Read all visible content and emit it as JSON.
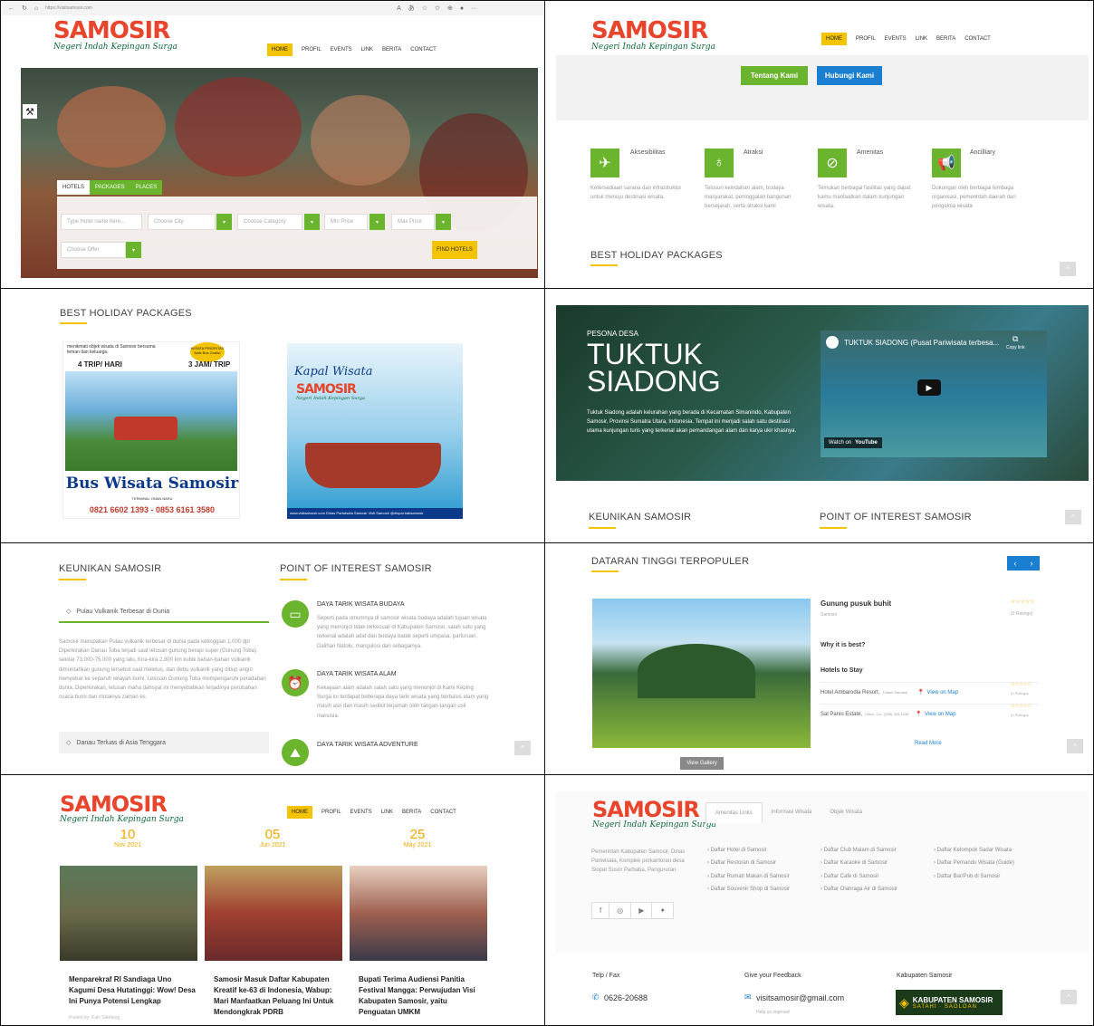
{
  "panel1": {
    "browser": {
      "url": "https://visitsamosir.com",
      "tab_icons": [
        "back-icon",
        "refresh-icon",
        "home-icon",
        "reader-icon",
        "zoom-icon",
        "translate-icon",
        "favorite-icon",
        "favorites-bar-icon",
        "extension-icon",
        "more-icon"
      ]
    },
    "logo": {
      "main": "SAMOSIR",
      "sub": "Negeri Indah Kepingan Surga"
    },
    "nav": [
      "HOME",
      "PROFIL",
      "EVENTS",
      "LINK",
      "BERITA",
      "CONTACT"
    ],
    "search_tabs": [
      "HOTELS",
      "PACKAGES",
      "PLACES"
    ],
    "fields": {
      "hotel": "Type Hotel name here...",
      "city": "Choose City",
      "category": "Choose Category",
      "min": "Min Price",
      "max": "Max Price",
      "offer": "Choose Offer"
    },
    "find_button": "FIND HOTELS"
  },
  "panel2": {
    "logo": {
      "main": "SAMOSIR",
      "sub": "Negeri Indah Kepingan Surga"
    },
    "nav": [
      "HOME",
      "PROFIL",
      "EVENTS",
      "LINK",
      "BERITA",
      "CONTACT"
    ],
    "buttons": {
      "about": "Tentang Kami",
      "contact": "Hubungi Kami"
    },
    "features": [
      {
        "title": "Aksesibilitas",
        "text": "Ketersediaan sarana dan infrastruktur untuk menuju destinasi wisata."
      },
      {
        "title": "Atraksi",
        "text": "Telusuri keindahan alam, budaya masyarakat, peninggalan bangunan bersejarah, serta atraksi kami"
      },
      {
        "title": "Amenitas",
        "text": "Temukan berbagai fasilitas yang dapat kamu manfaatkan dalam kunjungan wisata."
      },
      {
        "title": "Ancilliary",
        "text": "Dukungan oleh berbagai lembaga organisasi, pemerintah daerah dan pengelola wisata"
      }
    ],
    "section": "BEST HOLIDAY PACKAGES",
    "scroll_top": "^"
  },
  "panel3": {
    "section": "BEST HOLIDAY PACKAGES",
    "poster1": {
      "top": "menikmati objek wisata di Samosir bersama teman dan keluarga.",
      "left": "4 TRIP/ HARI",
      "right": "3 JAM/ TRIP",
      "badge": "WISATA PRIORITAS Naik Bus Gratis!",
      "title": "Bus Wisata Samosir",
      "terminal": "TERMINAL ONAN BARU",
      "phone": "0821 6602 1393 - 0853 6161 3580"
    },
    "poster2": {
      "title": "Kapal Wisata",
      "logo": "SAMOSIR",
      "sub": "Negeri Indah Kepingan Surga",
      "footer": "www.visitsamosir.com  Dinas Pariwisata Samosir  Visit Samosir  @dispar.kabsamosir"
    }
  },
  "panel4": {
    "kicker": "PESONA DESA",
    "title1": "TUKTUK",
    "title2": "SIADONG",
    "text": "Tuktuk Siadong adalah kelurahan yang berada di Kecamatan Simanindo, Kabupaten Samosir, Provinsi Sumatra Utara, Indonesia. Tempat ini menjadi salah satu destinasi utama kunjungan turis yang terkenal akan pemandangan alam dan karya ukir khasnya.",
    "video_title": "TUKTUK SIADONG (Pusat Pariwisata terbesa...",
    "copy_link": "Copy link",
    "watch_on": "Watch on",
    "youtube": "YouTube",
    "tab_left": "KEUNIKAN SAMOSIR",
    "tab_right": "POINT OF INTEREST SAMOSIR"
  },
  "panel5": {
    "left_title": "KEUNIKAN SAMOSIR",
    "right_title": "POINT OF INTEREST SAMOSIR",
    "acc1": "Pulau Vulkanik Terbesar di Dunia",
    "acc1_text": "Samosir merupakan Pulau vulkanik terbesar di dunia pada ketinggian 1.000 dpl Diperkirakan Danau Toba terjadi saat letusan gunung berapi super (Gunung Toba) sekitar 73.000-75.000 yang lalu. Kira-kira 2.800 km kubik bahan-bahan vulkanik dimuntahkan gunung tersebut saat meletus, dan debu vulkanik yang ditiup angin menyebar ke separuh wilayah bumi. Letusan Gunung Toba mempengaruhi peradaban dunia. Diperkirakan, letusan maha dahsyat ini menyebabkan terjadinya perubahan cuaca bumi dan mulainya zaman es",
    "acc2": "Danau Terluas di Asia Tenggara",
    "poi": [
      {
        "title": "DAYA TARIK WISATA BUDAYA",
        "text": "Seperti pada umumnya di samosir wisata budaya adalah tujuan wisata yang menonjol tidak terkecuali di Kabupaten Samosir, salah satu yang terkenal adalah adat dan budaya batak seperti umpasa, parturuan, Dalihan Natolu, mangulosi dan sebagainya."
      },
      {
        "title": "DAYA TARIK WISATA ALAM",
        "text": "Kekayaan alam adalah salah satu yang menonjol di Kami Keping Surga ini terdapat beberapa daya tarik wisata yang berbasis alam yang masih asri dan masih sedikit terjamah oleh tangan-tangan usil manusia."
      },
      {
        "title": "DAYA TARIK WISATA ADVENTURE",
        "text": ""
      }
    ]
  },
  "panel6": {
    "title": "DATARAN TINGGI TERPOPULER",
    "place": "Gunung pusuk buhit",
    "location": "Samosir",
    "ratings": "(0 Ratings)",
    "why": "Why it is best?",
    "hotels_label": "Hotels to Stay",
    "hotels": [
      {
        "name": "Hotel Ambarodia Resort,",
        "loc": "Tuktuk Samosir",
        "link": "View on Map",
        "ratings": "(0 Ratings)"
      },
      {
        "name": "Sal Panio Estate,",
        "loc": "Chico, Ca - (530) 303-1234",
        "link": "View on Map",
        "ratings": "(0 Ratings)"
      }
    ],
    "read_more": "Read More",
    "gallery": "View Gallery"
  },
  "panel7": {
    "logo": {
      "main": "SAMOSIR",
      "sub": "Negeri Indah Kepingan Surga"
    },
    "nav": [
      "HOME",
      "PROFIL",
      "EVENTS",
      "LINK",
      "BERITA",
      "CONTACT"
    ],
    "news": [
      {
        "day": "10",
        "month": "Nov 2021",
        "title": "Menparekraf RI Sandiaga Uno Kagumi Desa Hutatinggi: Wow! Desa Ini Punya Potensi Lengkap",
        "meta": "Posted by: Kalo Sitohang"
      },
      {
        "day": "05",
        "month": "Jun 2021",
        "title": "Samosir Masuk Daftar Kabupaten Kreatif ke-63 di Indonesia, Wabup: Mari Manfaatkan Peluang Ini Untuk Mendongkrak PDRB",
        "meta": ""
      },
      {
        "day": "25",
        "month": "May 2021",
        "title": "Bupati Terima Audiensi Panitia Festival Mangga: Perwujudan Visi Kabupaten Samosir, yaitu Penguatan UMKM",
        "meta": ""
      }
    ]
  },
  "panel8": {
    "logo": {
      "main": "SAMOSIR",
      "sub": "Negeri Indah Kepingan Surga"
    },
    "tabs": [
      "Amenitas Links",
      "Informasi Wisata",
      "Objek Wisata"
    ],
    "address": "Pemerintah Kabupaten Samosir, Dinas Pariwisata, Komplek perkantoran desa Siopat Sosor Parbaba, Pangururan.",
    "col1": [
      "Daftar Hotel di Samosir",
      "Daftar Restoran di Samosir",
      "Daftar Rumah Makan di Samosir",
      "Daftar Souvenir Shop di Samosir"
    ],
    "col2": [
      "Daftar Club Malam di Samosir",
      "Daftar Karaoke di Samosir",
      "Daftar Cafe di Samosir",
      "Daftar Olahraga Air di Samosir"
    ],
    "col3": [
      "Daftar Kelompok Sadar Wisata",
      "Daftar Pemandu Wisata (Guide)",
      "Daftar Bar/Pub di Samosir"
    ],
    "telp_label": "Telp / Fax",
    "telp": "0626-20688",
    "feedback_label": "Give your Feedback",
    "email": "visitsamosir@gmail.com",
    "help": "Help us improve!",
    "kab_label": "Kabupaten Samosir",
    "kab_badge": "KABUPATEN SAMOSIR",
    "kab_sub": "SATAHI · SAOLOAN"
  }
}
